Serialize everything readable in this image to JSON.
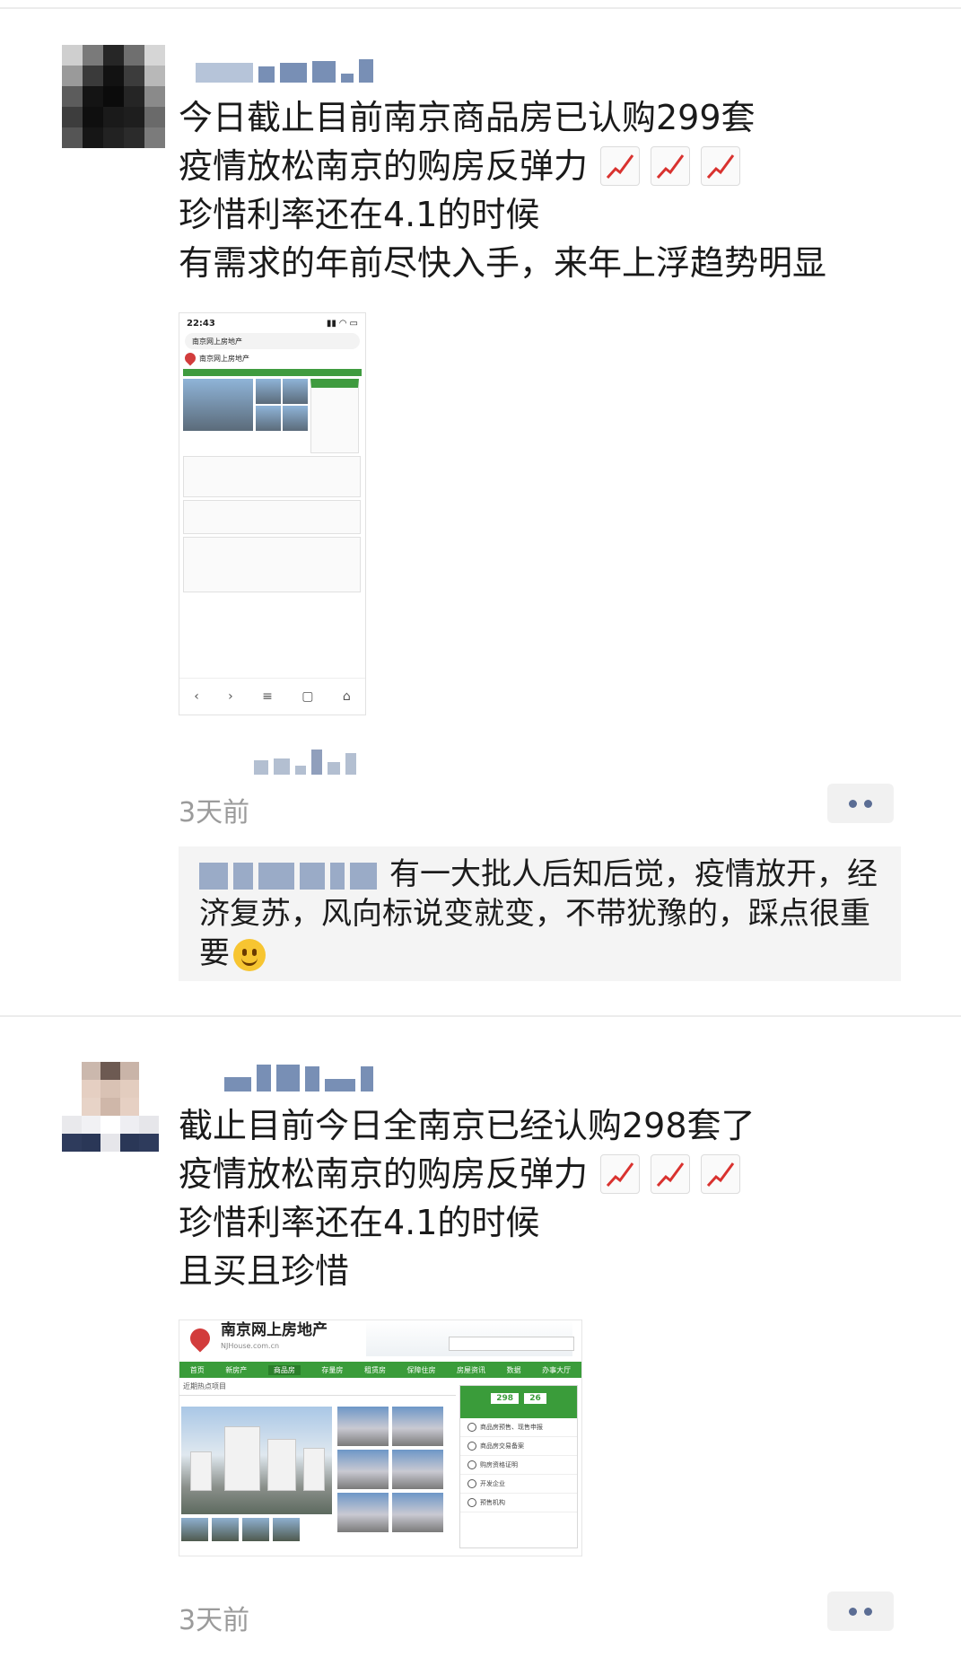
{
  "posts": [
    {
      "text_lines": [
        "今日截止目前南京商品房已认购299套",
        "疫情放松南京的购房反弹力",
        "珍惜利率还在4.1的时候",
        "有需求的年前尽快入手，来年上浮趋势明显"
      ],
      "trend_icon": "chart-increasing-emoji",
      "time": "3天前",
      "image": {
        "status_time": "22:43",
        "tab_title": "南京网上房地产",
        "site_title": "南京网上房地产"
      },
      "comment": {
        "text": "有一大批人后知后觉，疫情放开，经济复苏，风向标说变就变，不带犹豫的，踩点很重要"
      }
    },
    {
      "text_lines": [
        "截止目前今日全南京已经认购298套了",
        "疫情放松南京的购房反弹力",
        "珍惜利率还在4.1的时候",
        "且买且珍惜"
      ],
      "trend_icon": "chart-increasing-emoji",
      "time": "3天前",
      "image": {
        "brand": "南京网上房地产",
        "brand_url": "NJHouse.com.cn",
        "nav_items": [
          "首页",
          "新房产",
          "商品房",
          "存量房",
          "租赁房",
          "保障住房",
          "房屋资讯",
          "数据",
          "办事大厅"
        ],
        "subheading": "近期热点项目",
        "stats": [
          "298",
          "26"
        ],
        "side_items": [
          "商品房预售、现售申报",
          "商品房交易备案",
          "购房资格证明",
          "开发企业",
          "预售机构"
        ]
      }
    }
  ],
  "colors": {
    "name_blue": "#576b95",
    "nav_green": "#3a9c3a",
    "emoji_red": "#d9322f"
  }
}
